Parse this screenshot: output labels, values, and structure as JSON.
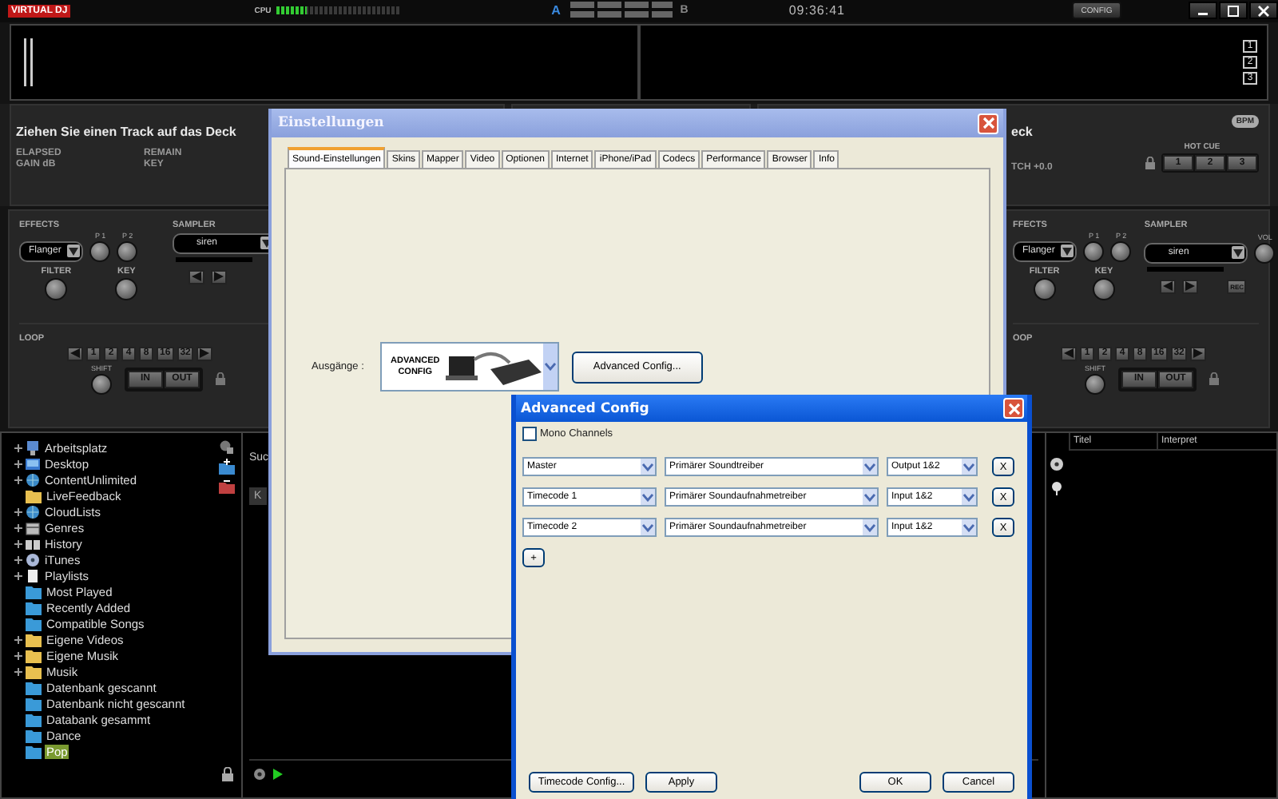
{
  "topbar": {
    "logo": "VIRTUAL DJ",
    "cpu_label": "CPU",
    "cpu": {
      "level": 0.25
    },
    "deck_a": "A",
    "deck_b": "B",
    "clock": "09:36:41",
    "config_button": "CONFIG"
  },
  "waveform": {
    "page_buttons": [
      "1",
      "2",
      "3"
    ]
  },
  "deck_left": {
    "title": "Ziehen Sie einen Track auf das Deck",
    "info_labels": [
      "ELAPSED",
      "REMAIN",
      "GAIN dB",
      "KEY"
    ]
  },
  "deck_right": {
    "title": "eck",
    "pitch": "TCH +0.0",
    "bpm_badge": "BPM",
    "hot_cue_label": "HOT CUE",
    "hot_cues": [
      "1",
      "2",
      "3"
    ]
  },
  "controls": [
    {
      "effects_label": "EFFECTS",
      "effect": "Flanger",
      "param_labels": [
        "P 1",
        "P 2"
      ],
      "filter_label": "FILTER",
      "key_label": "KEY",
      "sampler_label": "SAMPLER",
      "sample": "siren",
      "loop_label": "LOOP",
      "loop_buttons": [
        "1",
        "2",
        "4",
        "8",
        "16",
        "32"
      ],
      "shift_label": "SHIFT",
      "in_button": "IN",
      "out_button": "OUT"
    },
    {
      "effects_label": "FFECTS",
      "effect": "Flanger",
      "param_labels": [
        "P 1",
        "P 2"
      ],
      "filter_label": "FILTER",
      "key_label": "KEY",
      "sampler_label": "SAMPLER",
      "sample": "siren",
      "vol_label": "VOL",
      "rec_button": "REC",
      "loop_label": "OOP",
      "loop_buttons": [
        "1",
        "2",
        "4",
        "8",
        "16",
        "32"
      ],
      "shift_label": "SHIFT",
      "in_button": "IN",
      "out_button": "OUT"
    }
  ],
  "browser": {
    "tree": [
      {
        "label": "Arbeitsplatz",
        "kind": "monitor",
        "expandable": true,
        "selected": false
      },
      {
        "label": "Desktop",
        "kind": "desktop",
        "expandable": true,
        "selected": false
      },
      {
        "label": "ContentUnlimited",
        "kind": "globe",
        "expandable": true,
        "selected": false
      },
      {
        "label": "LiveFeedback",
        "kind": "folder",
        "expandable": false,
        "selected": false
      },
      {
        "label": "CloudLists",
        "kind": "globe",
        "expandable": true,
        "selected": false
      },
      {
        "label": "Genres",
        "kind": "box",
        "expandable": true,
        "selected": false
      },
      {
        "label": "History",
        "kind": "book",
        "expandable": true,
        "selected": false
      },
      {
        "label": "iTunes",
        "kind": "disc",
        "expandable": true,
        "selected": false
      },
      {
        "label": "Playlists",
        "kind": "document",
        "expandable": true,
        "selected": false
      },
      {
        "label": "Most Played",
        "kind": "blue-folder",
        "expandable": false,
        "selected": false
      },
      {
        "label": "Recently Added",
        "kind": "blue-folder",
        "expandable": false,
        "selected": false
      },
      {
        "label": "Compatible Songs",
        "kind": "blue-folder",
        "expandable": false,
        "selected": false
      },
      {
        "label": "Eigene Videos",
        "kind": "folder",
        "expandable": true,
        "selected": false
      },
      {
        "label": "Eigene Musik",
        "kind": "folder",
        "expandable": true,
        "selected": false
      },
      {
        "label": "Musik",
        "kind": "folder",
        "expandable": true,
        "selected": false
      },
      {
        "label": "Datenbank gescannt",
        "kind": "blue-folder",
        "expandable": false,
        "selected": false
      },
      {
        "label": "Datenbank nicht gescannt",
        "kind": "blue-folder",
        "expandable": false,
        "selected": false
      },
      {
        "label": "Databank gesammt",
        "kind": "blue-folder",
        "expandable": false,
        "selected": false
      },
      {
        "label": "Dance",
        "kind": "blue-folder",
        "expandable": false,
        "selected": false
      },
      {
        "label": "Pop",
        "kind": "blue-folder",
        "expandable": false,
        "selected": true
      }
    ],
    "search_label": "Suc",
    "column_partial": "K",
    "columns": [
      "Titel",
      "Interpret"
    ]
  },
  "settings": {
    "title": "Einstellungen",
    "tabs": [
      {
        "label": "Sound-Einstellungen",
        "selected": true
      },
      {
        "label": "Skins",
        "selected": false
      },
      {
        "label": "Mapper",
        "selected": false
      },
      {
        "label": "Video",
        "selected": false
      },
      {
        "label": "Optionen",
        "selected": false
      },
      {
        "label": "Internet",
        "selected": false
      },
      {
        "label": "iPhone/iPad",
        "selected": false
      },
      {
        "label": "Codecs",
        "selected": false
      },
      {
        "label": "Performance",
        "selected": false
      },
      {
        "label": "Browser",
        "selected": false
      },
      {
        "label": "Info",
        "selected": false
      }
    ],
    "outputs_label": "Ausgänge :",
    "outputs_value": "ADVANCED CONFIG",
    "advanced_button": "Advanced Config..."
  },
  "advanced": {
    "title": "Advanced Config",
    "mono": {
      "label": "Mono Channels",
      "checked": false
    },
    "channels": [
      {
        "role": "Master",
        "driver": "Primärer Soundtreiber",
        "port": "Output 1&2",
        "remove": "X"
      },
      {
        "role": "Timecode 1",
        "driver": "Primärer Soundaufnahmetreiber",
        "port": "Input 1&2",
        "remove": "X"
      },
      {
        "role": "Timecode 2",
        "driver": "Primärer Soundaufnahmetreiber",
        "port": "Input 1&2",
        "remove": "X"
      }
    ],
    "add_button": "+",
    "timecode_button": "Timecode Config...",
    "apply_button": "Apply",
    "ok_button": "OK",
    "cancel_button": "Cancel"
  }
}
